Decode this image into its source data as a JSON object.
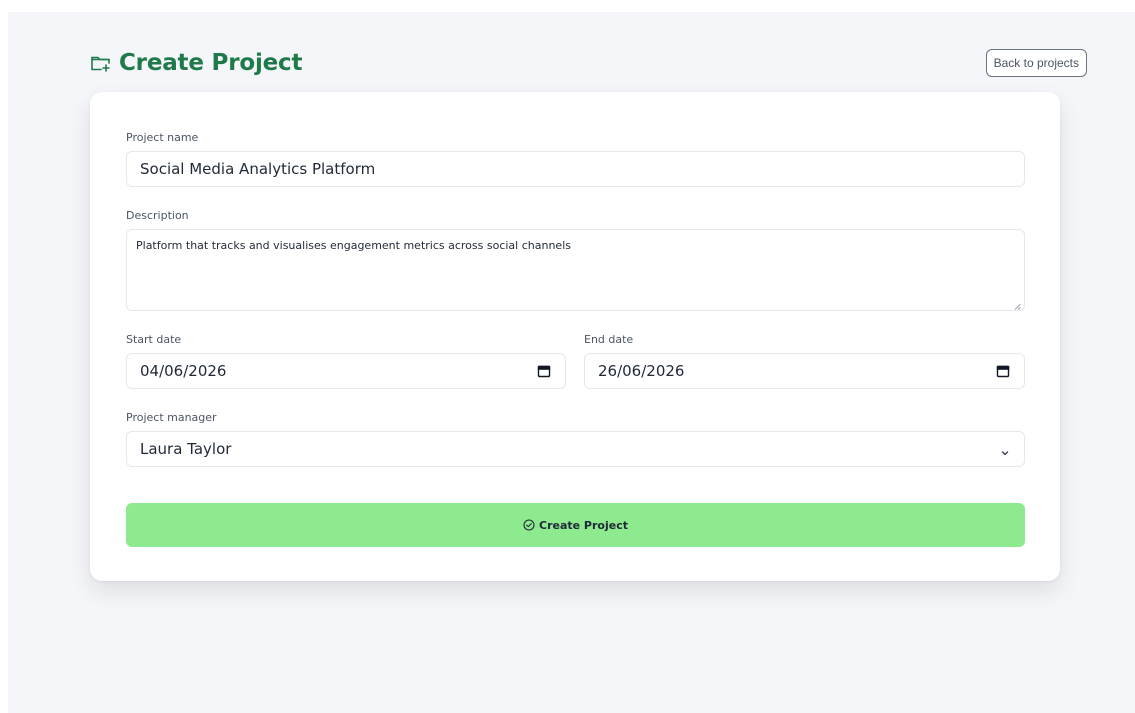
{
  "header": {
    "title": "Create Project",
    "back_label": "Back to projects",
    "title_icon": "folder-plus-icon"
  },
  "form": {
    "project_name": {
      "label": "Project name",
      "value": "Social Media Analytics Platform"
    },
    "description": {
      "label": "Description",
      "value": "Platform that tracks and visualises engagement metrics across social channels"
    },
    "start_date": {
      "label": "Start date",
      "value": "04/06/2026",
      "icon": "calendar-icon"
    },
    "end_date": {
      "label": "End date",
      "value": "26/06/2026",
      "icon": "calendar-icon"
    },
    "project_manager": {
      "label": "Project manager",
      "value": "Laura Taylor",
      "icon": "chevron-down-icon"
    },
    "submit_label": "Create Project",
    "submit_icon": "check-circle-icon"
  },
  "colors": {
    "brand_green": "#1f7a4a",
    "submit_bg": "#8eea8e",
    "page_bg": "#f4f6f9"
  }
}
